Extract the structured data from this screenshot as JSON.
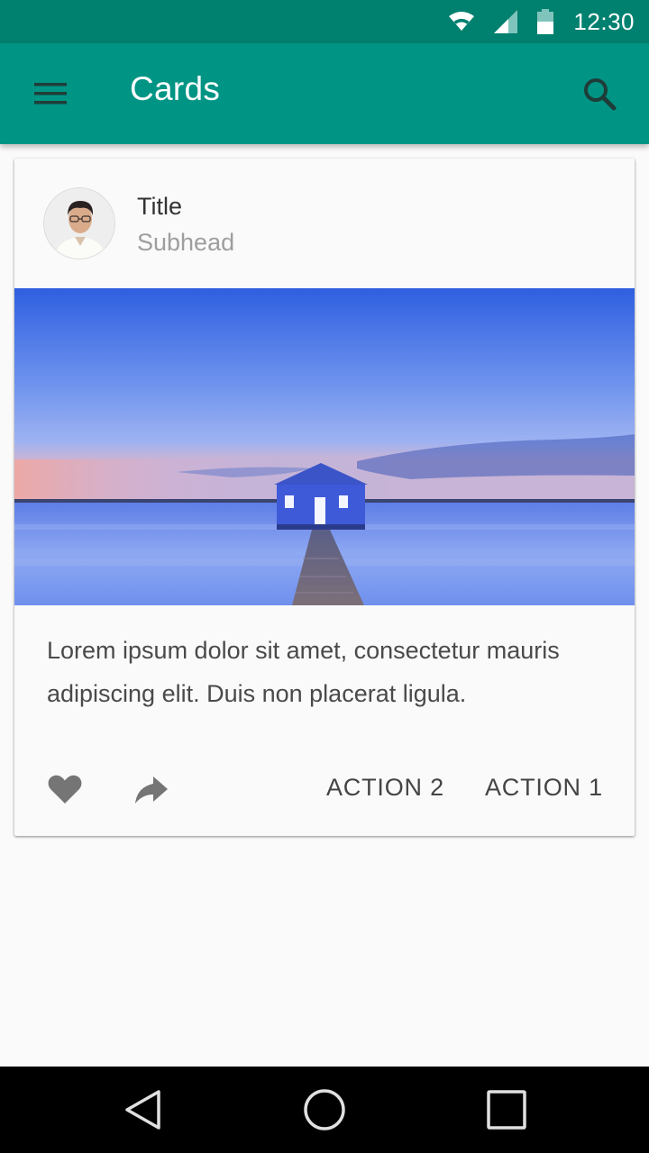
{
  "status_bar": {
    "time": "12:30",
    "icons": [
      "wifi-icon",
      "signal-icon",
      "battery-icon"
    ],
    "background": "#00806f"
  },
  "app_bar": {
    "title": "Cards",
    "menu_icon": "menu-icon",
    "search_icon": "search-icon",
    "background": "#009485"
  },
  "card": {
    "title": "Title",
    "subhead": "Subhead",
    "avatar": "avatar-photo",
    "media": "boathouse-on-lake-photo",
    "supporting_text": "Lorem ipsum dolor sit amet, consectetur mauris adipiscing elit. Duis non placerat ligula.",
    "actions": {
      "favorite_icon": "heart-icon",
      "share_icon": "share-icon",
      "action_2": "ACTION 2",
      "action_1": "ACTION 1"
    }
  },
  "nav_bar": {
    "buttons": [
      "back-icon",
      "home-icon",
      "recents-icon"
    ]
  }
}
